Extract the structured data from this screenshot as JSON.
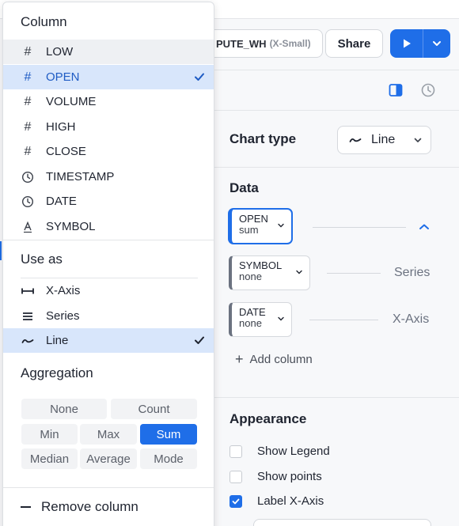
{
  "toolbar": {
    "warehouse_name": "PUTE_WH",
    "warehouse_size": "(X-Small)",
    "share_label": "Share"
  },
  "chart_panel": {
    "chart_type_label": "Chart type",
    "chart_type_value": "Line",
    "data_label": "Data",
    "columns": [
      {
        "name": "OPEN",
        "agg": "sum",
        "role": ""
      },
      {
        "name": "SYMBOL",
        "agg": "none",
        "role": "Series"
      },
      {
        "name": "DATE",
        "agg": "none",
        "role": "X-Axis"
      }
    ],
    "add_column_label": "Add column",
    "appearance_label": "Appearance",
    "appearance_options": [
      {
        "label": "Show Legend",
        "checked": false
      },
      {
        "label": "Show points",
        "checked": false
      },
      {
        "label": "Label X-Axis",
        "checked": true
      }
    ]
  },
  "popup": {
    "column_title": "Column",
    "columns": [
      {
        "label": "LOW",
        "icon": "hash-icon",
        "state": "hover"
      },
      {
        "label": "OPEN",
        "icon": "hash-icon",
        "state": "selected"
      },
      {
        "label": "VOLUME",
        "icon": "hash-icon",
        "state": ""
      },
      {
        "label": "HIGH",
        "icon": "hash-icon",
        "state": ""
      },
      {
        "label": "CLOSE",
        "icon": "hash-icon",
        "state": ""
      },
      {
        "label": "TIMESTAMP",
        "icon": "clock-icon",
        "state": ""
      },
      {
        "label": "DATE",
        "icon": "clock-icon",
        "state": ""
      },
      {
        "label": "SYMBOL",
        "icon": "text-icon",
        "state": ""
      }
    ],
    "use_as_title": "Use as",
    "use_as": [
      {
        "label": "X-Axis",
        "icon": "x-axis-icon",
        "state": ""
      },
      {
        "label": "Series",
        "icon": "series-icon",
        "state": ""
      },
      {
        "label": "Line",
        "icon": "line-icon",
        "state": "selected"
      }
    ],
    "aggregation_title": "Aggregation",
    "aggregation": [
      "None",
      "Count",
      "Min",
      "Max",
      "Sum",
      "Median",
      "Average",
      "Mode"
    ],
    "aggregation_selected": "Sum",
    "remove_label": "Remove column"
  },
  "colors": {
    "accent": "#1f6ee8",
    "selected_bg": "#d8e6fb",
    "hover_bg": "#eef0f3"
  }
}
